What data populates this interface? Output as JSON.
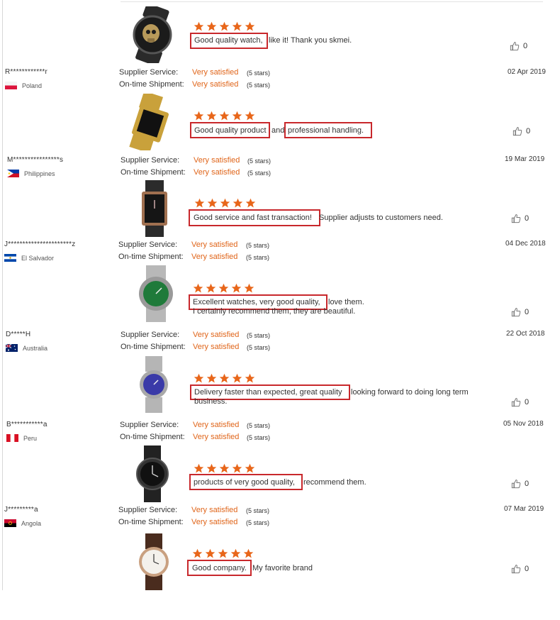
{
  "labels": {
    "supplier_service": "Supplier Service:",
    "on_time_shipment": "On-time Shipment:"
  },
  "rating": {
    "value": "Very satisfied",
    "stars_text": "(5 stars)"
  },
  "colors": {
    "star": "#e8661a",
    "highlight": "#c8282c",
    "rating_text": "#e0651a"
  },
  "reviews": [
    {
      "watch_icon": "skull-watch-icon",
      "highlights": [
        "Good quality watch,"
      ],
      "text": " like it! Thank you skmei.",
      "text2": "",
      "likes": "0",
      "user": "R************r",
      "country": "Poland",
      "flag": "poland-flag-icon",
      "date": "02 Apr 2019"
    },
    {
      "watch_icon": "gold-square-watch-icon",
      "highlights": [
        "Good quality product",
        "professional handling."
      ],
      "text": "and",
      "text2": "",
      "likes": "0",
      "user": "M****************s",
      "country": "Philippines",
      "flag": "philippines-flag-icon",
      "date": "19 Mar 2019"
    },
    {
      "watch_icon": "rectangular-watch-icon",
      "highlights": [
        "Good service and fast transaction!"
      ],
      "text": " Supplier adjusts to customers need.",
      "text2": "",
      "likes": "0",
      "user": "J**********************z",
      "country": "El Salvador",
      "flag": "el-salvador-flag-icon",
      "date": "04 Dec 2018"
    },
    {
      "watch_icon": "green-dial-watch-icon",
      "highlights": [
        "Excellent watches, very good quality,"
      ],
      "text": " love them.",
      "text2": "I certainly recommend them, they are beautiful.",
      "likes": "0",
      "user": "D*****H",
      "country": "Australia",
      "flag": "australia-flag-icon",
      "date": "22 Oct 2018"
    },
    {
      "watch_icon": "blue-dial-watch-icon",
      "highlights": [
        "Delivery faster than expected, great quality"
      ],
      "text": " looking forward to doing long term",
      "text2": "business.",
      "likes": "0",
      "user": "B***********a",
      "country": "Peru",
      "flag": "peru-flag-icon",
      "date": "05 Nov 2018"
    },
    {
      "watch_icon": "black-watch-icon",
      "highlights": [
        "products of very good quality,"
      ],
      "text": " recommend them.",
      "text2": "",
      "likes": "0",
      "user": "J*********a",
      "country": "Angola",
      "flag": "angola-flag-icon",
      "date": "07 Mar 2019"
    },
    {
      "watch_icon": "leather-strap-watch-icon",
      "highlights": [
        "Good company."
      ],
      "text": " My favorite brand",
      "text2": "",
      "likes": "0"
    }
  ]
}
